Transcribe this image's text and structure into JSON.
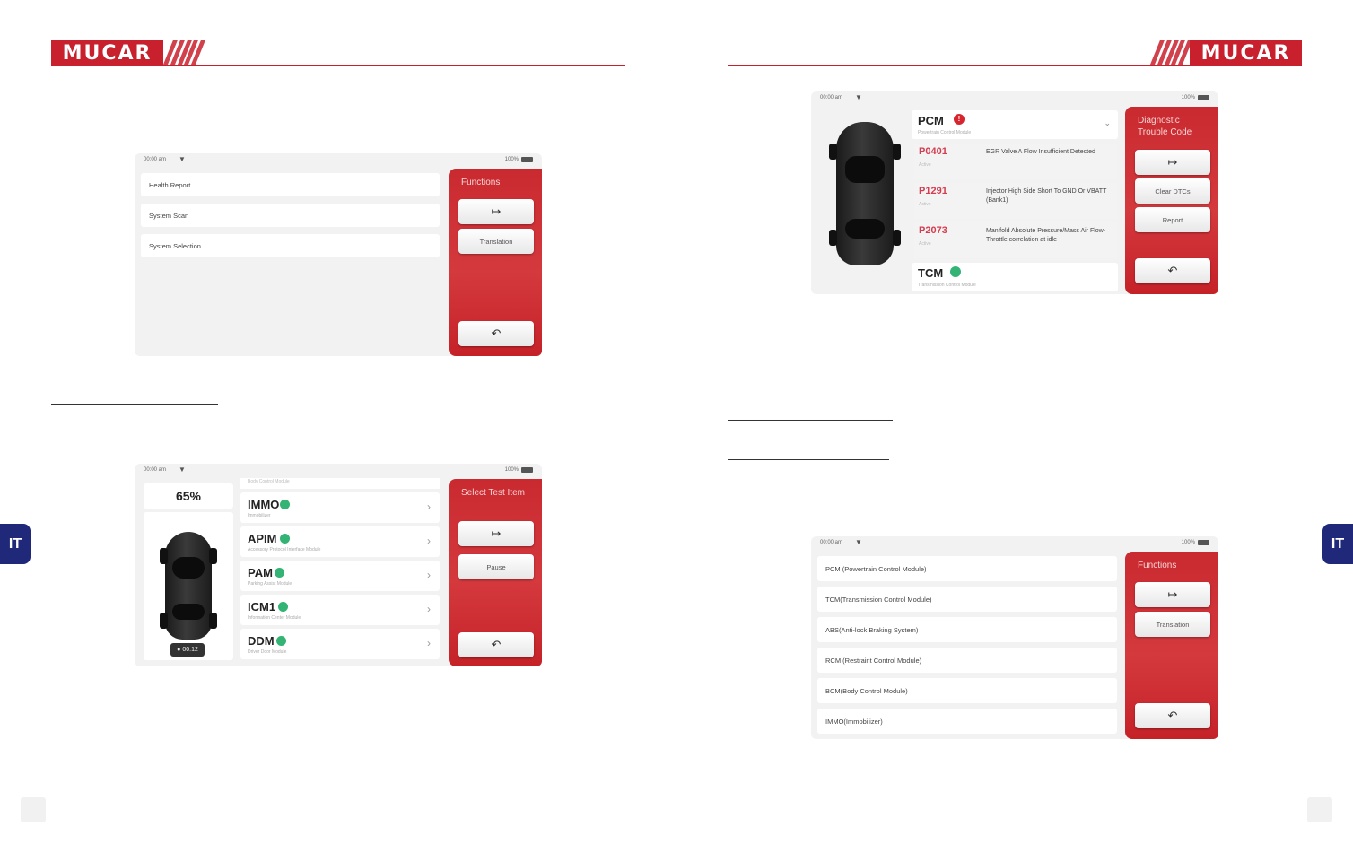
{
  "header": {
    "brand": "MUCAR"
  },
  "side_tabs": {
    "left": "IT",
    "right": "IT"
  },
  "shot1": {
    "status": {
      "time": "00:00 am",
      "battery": "100%"
    },
    "rows": [
      "Health Report",
      "System Scan",
      "System Selection"
    ],
    "panel": {
      "title": "Functions",
      "translation": "Translation"
    }
  },
  "shot2": {
    "status": {
      "time": "00:00 am",
      "battery": "100%"
    },
    "progress": "65%",
    "progress_value": 0.65,
    "timer": "00:12",
    "top_row_fragment": "Body Control Module",
    "modules": [
      {
        "name": "IMMO",
        "sub": "Immobilizer"
      },
      {
        "name": "APIM",
        "sub": "Accessory Protocol Interface Module"
      },
      {
        "name": "PAM",
        "sub": "Parking Assist Module"
      },
      {
        "name": "ICM1",
        "sub": "Information Center Module"
      },
      {
        "name": "DDM",
        "sub": "Driver Door Module"
      }
    ],
    "panel": {
      "title": "Select Test Item",
      "pause": "Pause"
    }
  },
  "shot3": {
    "status": {
      "time": "00:00 am",
      "battery": "100%"
    },
    "pcm": {
      "name": "PCM",
      "sub": "Powertrain Control Module"
    },
    "dtcs": [
      {
        "code": "P0401",
        "status": "Active",
        "desc": "EGR Valve A Flow Insufficient Detected"
      },
      {
        "code": "P1291",
        "status": "Active",
        "desc": "Injector High Side Short To GND Or VBATT (Bank1)"
      },
      {
        "code": "P2073",
        "status": "Active",
        "desc": "Manifold Absolute Pressure/Mass Air Flow-Throttle correlation at idle"
      }
    ],
    "tcm": {
      "name": "TCM",
      "sub": "Transmission Control Module"
    },
    "panel": {
      "title": "Diagnostic Trouble Code",
      "clear": "Clear DTCs",
      "report": "Report"
    }
  },
  "shot4": {
    "status": {
      "time": "00:00 am",
      "battery": "100%"
    },
    "rows": [
      "PCM (Powertrain Control Module)",
      "TCM(Transmission Control Module)",
      "ABS(Anti-lock Braking System)",
      "RCM (Restraint Control Module)",
      "BCM(Body Control Module)",
      "IMMO(Immobilizer)"
    ],
    "panel": {
      "title": "Functions",
      "translation": "Translation"
    }
  },
  "colors": {
    "brand_red": "#c8202c",
    "tab_blue": "#20287a",
    "ok_green": "#33b374",
    "error_red": "#d63c4f"
  },
  "icons": {
    "exit": "exit-icon",
    "back": "back-icon",
    "wifi": "wifi-icon",
    "battery": "battery-icon",
    "chevron": "chevron-right-icon"
  }
}
